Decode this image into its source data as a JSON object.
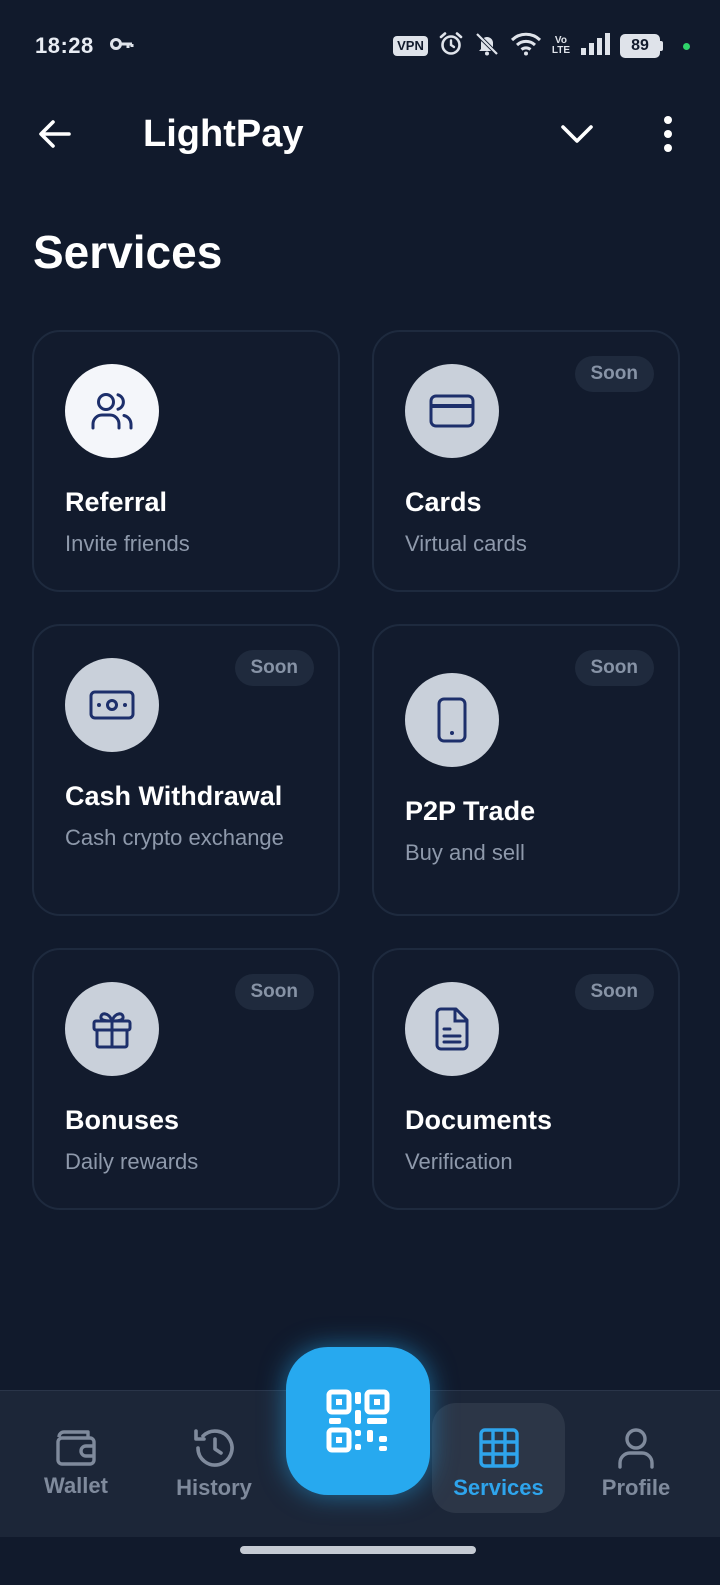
{
  "status_bar": {
    "time": "18:28",
    "vpn": "VPN",
    "volte_top": "Vo",
    "volte_bottom": "LTE",
    "battery": "89"
  },
  "app_bar": {
    "title": "LightPay"
  },
  "page": {
    "title": "Services"
  },
  "services": [
    {
      "title": "Referral",
      "subtitle": "Invite friends",
      "badge": "",
      "icon": "users-icon"
    },
    {
      "title": "Cards",
      "subtitle": "Virtual cards",
      "badge": "Soon",
      "icon": "credit-card-icon"
    },
    {
      "title": "Cash Withdrawal",
      "subtitle": "Cash crypto exchange",
      "badge": "Soon",
      "icon": "banknote-icon"
    },
    {
      "title": "P2P Trade",
      "subtitle": "Buy and sell",
      "badge": "Soon",
      "icon": "smartphone-icon"
    },
    {
      "title": "Bonuses",
      "subtitle": "Daily rewards",
      "badge": "Soon",
      "icon": "gift-icon"
    },
    {
      "title": "Documents",
      "subtitle": "Verification",
      "badge": "Soon",
      "icon": "document-icon"
    }
  ],
  "bottom_nav": {
    "items": [
      {
        "label": "Wallet",
        "icon": "wallet-icon",
        "active": false
      },
      {
        "label": "History",
        "icon": "history-icon",
        "active": false
      },
      {
        "label": "Services",
        "icon": "grid-icon",
        "active": true
      },
      {
        "label": "Profile",
        "icon": "user-icon",
        "active": false
      }
    ],
    "scan_icon": "qr-code-icon"
  },
  "colors": {
    "background": "#111a2c",
    "accent": "#27a9ef",
    "icon_navy": "#1d2f6b"
  }
}
